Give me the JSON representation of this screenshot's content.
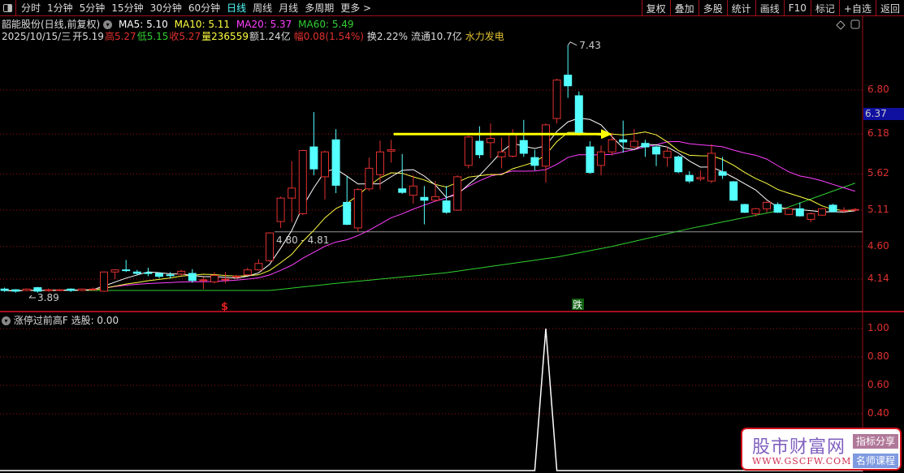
{
  "menubar": {
    "periods": [
      "分时",
      "1分钟",
      "5分钟",
      "15分钟",
      "30分钟",
      "60分钟",
      "日线",
      "周线",
      "月线",
      "多周期",
      "更多 >"
    ],
    "active": "日线",
    "right_buttons": [
      "复权",
      "叠加",
      "多股",
      "统计",
      "画线",
      "F10",
      "标记",
      "+自选",
      "返回"
    ]
  },
  "info": {
    "stock": "韶能股份(日线,前复权)",
    "ma5": "MA5: 5.10",
    "ma10": "MA10: 5.11",
    "ma20": "MA20: 5.37",
    "ma60": "MA60: 5.49",
    "date": "2025/10/15/三",
    "open": "开5.19",
    "high": "高5.27",
    "low": "低5.15",
    "close": "收5.27",
    "volume": "量236559",
    "amount": "额1.24亿",
    "change": "幅0.08(1.54%)",
    "turnover": "换2.22%",
    "float": "流通10.7亿",
    "sector": "水力发电"
  },
  "colors": {
    "up": "#e03030",
    "down": "#54ffff",
    "ma5": "#ffffff",
    "ma10": "#ffff40",
    "ma20": "#ff40ff",
    "ma60": "#30d030",
    "grid": "#a0101a",
    "arrow": "#ffff00"
  },
  "chart_data": [
    {
      "type": "candlestick",
      "yaxis_ticks": [
        6.8,
        6.18,
        5.62,
        5.11,
        4.6,
        4.14
      ],
      "current_price": "6.37",
      "annotations": {
        "high": "7.43",
        "low": "3.89",
        "support": "4.80 - 4.81",
        "signal_up": "$",
        "signal_down": "跌"
      },
      "candles": [
        [
          4.0,
          3.98,
          4.02,
          3.96
        ],
        [
          3.99,
          3.97,
          4.0,
          3.95
        ],
        [
          3.98,
          4.0,
          4.01,
          3.97
        ],
        [
          4.02,
          3.97,
          4.03,
          3.95
        ],
        [
          3.98,
          3.99,
          4.01,
          3.96
        ],
        [
          3.98,
          3.99,
          4.0,
          3.97
        ],
        [
          4.0,
          3.98,
          4.01,
          3.96
        ],
        [
          3.98,
          4.0,
          4.01,
          3.97
        ],
        [
          3.99,
          4.0,
          4.02,
          3.98
        ],
        [
          3.97,
          4.24,
          4.25,
          3.96
        ],
        [
          4.24,
          4.27,
          4.28,
          4.14
        ],
        [
          4.27,
          4.26,
          4.41,
          4.24
        ],
        [
          4.24,
          4.22,
          4.27,
          4.2
        ],
        [
          4.23,
          4.22,
          4.3,
          4.18
        ],
        [
          4.22,
          4.18,
          4.23,
          4.15
        ],
        [
          4.2,
          4.19,
          4.24,
          4.15
        ],
        [
          4.21,
          4.25,
          4.27,
          4.19
        ],
        [
          4.22,
          4.12,
          4.28,
          4.09
        ],
        [
          4.13,
          4.13,
          4.17,
          4.0
        ],
        [
          4.1,
          4.19,
          4.24,
          4.08
        ],
        [
          4.14,
          4.14,
          4.24,
          4.08
        ],
        [
          4.17,
          4.18,
          4.2,
          4.15
        ],
        [
          4.2,
          4.27,
          4.3,
          4.19
        ],
        [
          4.27,
          4.36,
          4.42,
          4.26
        ],
        [
          4.4,
          4.79,
          4.8,
          4.38
        ],
        [
          4.95,
          5.28,
          5.3,
          4.86
        ],
        [
          5.28,
          5.42,
          5.8,
          4.94
        ],
        [
          5.06,
          5.95,
          5.96,
          5.04
        ],
        [
          6.0,
          5.69,
          6.49,
          5.6
        ],
        [
          5.58,
          5.93,
          5.95,
          5.26
        ],
        [
          6.1,
          5.46,
          6.25,
          5.35
        ],
        [
          5.22,
          4.91,
          5.59,
          4.9
        ],
        [
          4.86,
          5.4,
          5.42,
          4.81
        ],
        [
          5.41,
          5.7,
          5.85,
          5.38
        ],
        [
          5.61,
          5.93,
          6.09,
          5.4
        ],
        [
          5.94,
          5.96,
          6.1,
          5.78
        ],
        [
          5.41,
          5.36,
          5.9,
          5.34
        ],
        [
          5.32,
          5.45,
          5.6,
          5.2
        ],
        [
          5.29,
          5.25,
          5.45,
          4.91
        ],
        [
          5.25,
          5.3,
          5.52,
          5.23
        ],
        [
          5.24,
          5.08,
          5.45,
          5.06
        ],
        [
          5.11,
          5.58,
          5.6,
          5.1
        ],
        [
          5.74,
          6.14,
          6.16,
          5.7
        ],
        [
          6.08,
          5.89,
          6.29,
          5.84
        ],
        [
          6.06,
          6.12,
          6.33,
          5.84
        ],
        [
          5.86,
          5.93,
          6.13,
          5.7
        ],
        [
          5.87,
          6.19,
          6.25,
          5.85
        ],
        [
          6.09,
          5.91,
          6.38,
          5.86
        ],
        [
          5.85,
          5.74,
          5.96,
          5.67
        ],
        [
          5.73,
          6.31,
          6.33,
          5.5
        ],
        [
          6.4,
          6.94,
          6.96,
          6.33
        ],
        [
          7.01,
          6.86,
          7.43,
          6.69
        ],
        [
          6.72,
          6.18,
          6.78,
          6.16
        ],
        [
          6.0,
          5.64,
          6.08,
          5.62
        ],
        [
          5.74,
          5.93,
          6.02,
          5.6
        ],
        [
          5.93,
          6.1,
          6.2,
          5.88
        ],
        [
          6.1,
          6.07,
          6.37,
          5.92
        ],
        [
          6.0,
          6.08,
          6.25,
          5.98
        ],
        [
          6.05,
          6.0,
          6.1,
          5.86
        ],
        [
          6.0,
          5.9,
          6.02,
          5.73
        ],
        [
          5.85,
          5.94,
          6.0,
          5.72
        ],
        [
          5.86,
          5.65,
          5.88,
          5.63
        ],
        [
          5.6,
          5.52,
          5.66,
          5.49
        ],
        [
          5.55,
          5.57,
          5.67,
          5.52
        ],
        [
          5.52,
          5.91,
          6.04,
          5.49
        ],
        [
          5.65,
          5.6,
          5.86,
          5.55
        ],
        [
          5.51,
          5.25,
          5.52,
          5.24
        ],
        [
          5.19,
          5.08,
          5.2,
          5.07
        ],
        [
          5.06,
          5.13,
          5.14,
          5.02
        ],
        [
          5.13,
          5.22,
          5.24,
          5.08
        ],
        [
          5.19,
          5.08,
          5.22,
          5.07
        ],
        [
          5.05,
          5.13,
          5.14,
          5.04
        ],
        [
          5.13,
          5.03,
          5.22,
          5.02
        ],
        [
          4.98,
          5.06,
          5.08,
          4.94
        ],
        [
          5.04,
          5.13,
          5.14,
          5.03
        ],
        [
          5.18,
          5.09,
          5.2,
          5.08
        ],
        [
          5.11,
          5.11,
          5.15,
          5.07
        ],
        [
          5.11,
          5.12,
          5.14,
          5.09
        ]
      ],
      "ma60_points": [
        [
          0,
          3.98
        ],
        [
          24,
          3.98
        ],
        [
          30,
          4.08
        ],
        [
          40,
          4.23
        ],
        [
          50,
          4.45
        ],
        [
          55,
          4.6
        ],
        [
          62,
          4.85
        ],
        [
          70,
          5.1
        ],
        [
          77,
          5.49
        ]
      ],
      "arrow": {
        "from_index": 35,
        "to_index": 54,
        "price": 6.18
      }
    },
    {
      "type": "line",
      "title": "涨停过前高F",
      "label": "选股: 0.00",
      "yaxis_ticks": [
        1.0,
        0.8,
        0.6,
        0.4
      ],
      "values_nonzero": {
        "index": 49,
        "value": 1.0
      }
    }
  ],
  "watermark": {
    "title": "股市财富网",
    "url": "WWW.GSCFW.COM",
    "tag1": "指标分享",
    "tag2": "名师课程"
  }
}
